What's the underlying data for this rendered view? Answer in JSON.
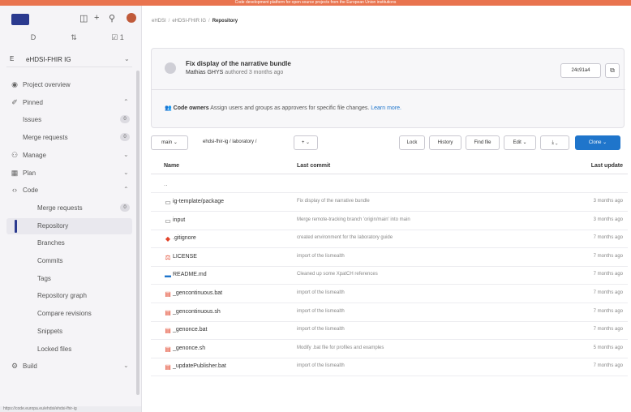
{
  "banner": "Code development platform for open source projects from the European Union institutions",
  "sidebar": {
    "counts": [
      {
        "icon": "issues-count-icon",
        "glyph": "D",
        "value": ""
      },
      {
        "icon": "merge-count-icon",
        "glyph": "⇅",
        "value": ""
      },
      {
        "icon": "todo-count-icon",
        "glyph": "☑",
        "value": "1"
      }
    ],
    "project": {
      "badge": "E",
      "name": "eHDSI-FHIR IG"
    },
    "items": [
      {
        "id": "project-overview",
        "icon": "◉",
        "label": "Project overview",
        "chev": "",
        "badge": "",
        "sub": false,
        "active": false
      },
      {
        "id": "pinned",
        "icon": "✐",
        "label": "Pinned",
        "chev": "⌃",
        "badge": "",
        "sub": false,
        "active": false
      },
      {
        "id": "issues",
        "icon": "",
        "label": "Issues",
        "chev": "",
        "badge": "0",
        "sub": false,
        "active": false
      },
      {
        "id": "merge-requests-pinned",
        "icon": "",
        "label": "Merge requests",
        "chev": "",
        "badge": "0",
        "sub": false,
        "active": false
      },
      {
        "id": "manage",
        "icon": "⚇",
        "label": "Manage",
        "chev": "⌄",
        "badge": "",
        "sub": false,
        "active": false
      },
      {
        "id": "plan",
        "icon": "▦",
        "label": "Plan",
        "chev": "⌄",
        "badge": "",
        "sub": false,
        "active": false
      },
      {
        "id": "code",
        "icon": "‹›",
        "label": "Code",
        "chev": "⌃",
        "badge": "",
        "sub": false,
        "active": false
      },
      {
        "id": "merge-requests",
        "icon": "",
        "label": "Merge requests",
        "chev": "",
        "badge": "0",
        "sub": true,
        "active": false
      },
      {
        "id": "repository",
        "icon": "",
        "label": "Repository",
        "chev": "",
        "badge": "",
        "sub": true,
        "active": true
      },
      {
        "id": "branches",
        "icon": "",
        "label": "Branches",
        "chev": "",
        "badge": "",
        "sub": true,
        "active": false
      },
      {
        "id": "commits",
        "icon": "",
        "label": "Commits",
        "chev": "",
        "badge": "",
        "sub": true,
        "active": false
      },
      {
        "id": "tags",
        "icon": "",
        "label": "Tags",
        "chev": "",
        "badge": "",
        "sub": true,
        "active": false
      },
      {
        "id": "repository-graph",
        "icon": "",
        "label": "Repository graph",
        "chev": "",
        "badge": "",
        "sub": true,
        "active": false
      },
      {
        "id": "compare-revisions",
        "icon": "",
        "label": "Compare revisions",
        "chev": "",
        "badge": "",
        "sub": true,
        "active": false
      },
      {
        "id": "snippets",
        "icon": "",
        "label": "Snippets",
        "chev": "",
        "badge": "",
        "sub": true,
        "active": false
      },
      {
        "id": "locked-files",
        "icon": "",
        "label": "Locked files",
        "chev": "",
        "badge": "",
        "sub": true,
        "active": false
      },
      {
        "id": "build",
        "icon": "⚙",
        "label": "Build",
        "chev": "⌄",
        "badge": "",
        "sub": false,
        "active": false
      }
    ],
    "footer_url": "https://code.europa.eu/ehdsi/ehdsi-fhir-ig"
  },
  "breadcrumb": {
    "parent1": "eHDSI",
    "parent2": "eHDSI-FHIR IG",
    "current": "Repository"
  },
  "commit": {
    "title": "Fix display of the narrative bundle",
    "author": "Mathias GHYS",
    "meta_suffix": "authored 3 months ago",
    "sha": "24c91a4",
    "copy_glyph": "⧉"
  },
  "codeowners": {
    "label": "Code owners",
    "text": "Assign users and groups as approvers for specific file changes.",
    "link": "Learn more."
  },
  "toolbar": {
    "branch": "main ⌄",
    "path": "ehdsi-fhir-ig / laboratory /",
    "add": "+ ⌄",
    "lock": "Lock",
    "history": "History",
    "find_file": "Find file",
    "edit": "Edit ⌄",
    "download": "⤓ ⌄",
    "clone": "Clone ⌄"
  },
  "table": {
    "headers": {
      "name": "Name",
      "last_commit": "Last commit",
      "last_update": "Last update"
    },
    "parent_link": "..",
    "rows": [
      {
        "type": "folder",
        "name": "ig-template/package",
        "commit": "Fix display of the narrative bundle",
        "time": "3 months ago"
      },
      {
        "type": "folder",
        "name": "input",
        "commit": "Merge remote-tracking branch 'origin/main' into main",
        "time": "3 months ago"
      },
      {
        "type": "git",
        "name": ".gitignore",
        "commit": "created environment for the laboratory guide",
        "time": "7 months ago"
      },
      {
        "type": "license",
        "name": "LICENSE",
        "commit": "import of the lismealth",
        "time": "7 months ago"
      },
      {
        "type": "md",
        "name": "README.md",
        "commit": "Cleaned up some XpatCH references",
        "time": "7 months ago"
      },
      {
        "type": "file",
        "name": "_gencontinuous.bat",
        "commit": "import of the lismealth",
        "time": "7 months ago"
      },
      {
        "type": "file",
        "name": "_gencontinuous.sh",
        "commit": "import of the lismealth",
        "time": "7 months ago"
      },
      {
        "type": "file",
        "name": "_genonce.bat",
        "commit": "import of the lismealth",
        "time": "7 months ago"
      },
      {
        "type": "file",
        "name": "_genonce.sh",
        "commit": "Modify .bat file for profiles and examples",
        "time": "5 months ago"
      },
      {
        "type": "file",
        "name": "_updatePublisher.bat",
        "commit": "import of the lismealth",
        "time": "7 months ago"
      }
    ]
  }
}
